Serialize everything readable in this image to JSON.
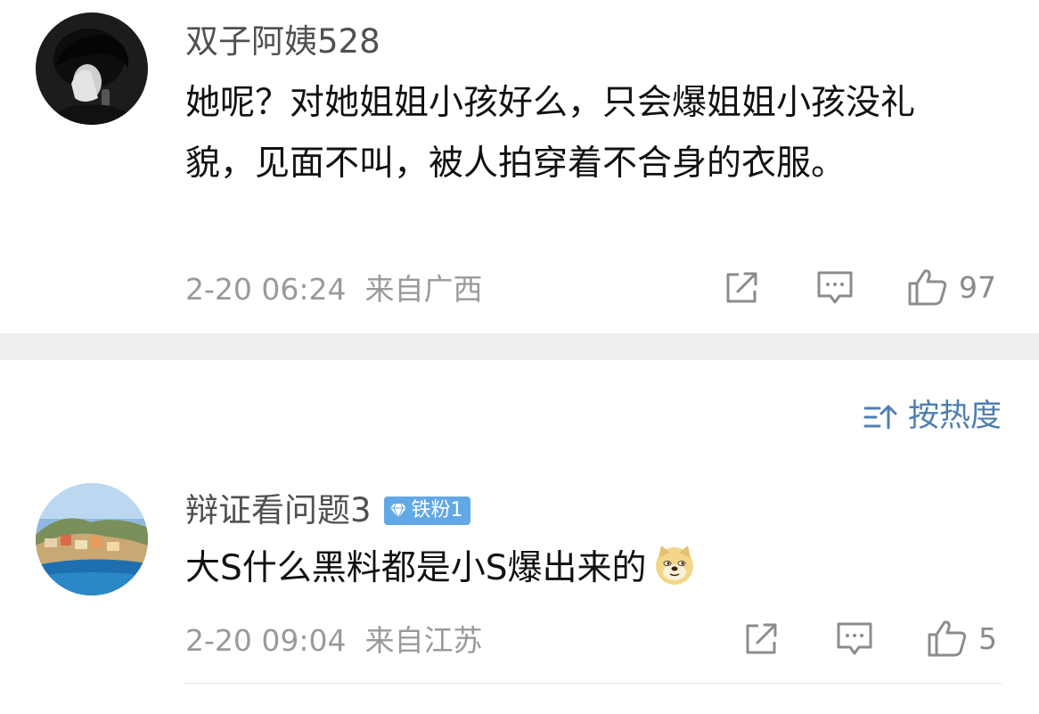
{
  "comments": [
    {
      "username": "双子阿姨528",
      "text": "她呢？对她姐姐小孩好么，只会爆姐姐小孩没礼貌，见面不叫，被人拍穿着不合身的衣服。",
      "time": "2-20 06:24",
      "location": "来自广西",
      "likes": "97"
    },
    {
      "username": "辩证看问题3",
      "badge": "铁粉1",
      "text": "大S什么黑料都是小S爆出来的",
      "emoji": "doge-emoji",
      "time": "2-20 09:04",
      "location": "来自江苏",
      "likes": "5"
    }
  ],
  "sort": {
    "label": "按热度",
    "icon": "sort-icon"
  },
  "icons": {
    "share": "share-icon",
    "comment": "comment-icon",
    "like": "thumbs-up-icon",
    "diamond": "diamond-icon"
  },
  "colors": {
    "sort_accent": "#4f7fb0",
    "badge_bg": "#62a8e6",
    "meta_gray": "#9a9a9a"
  }
}
